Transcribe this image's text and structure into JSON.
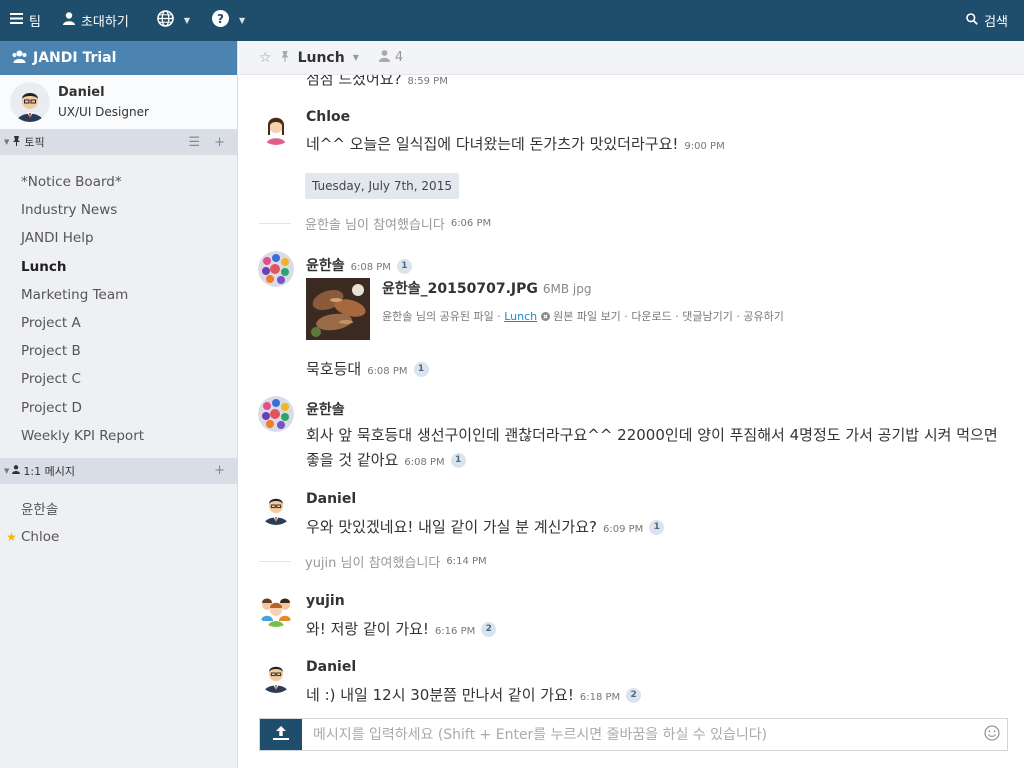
{
  "topbar": {
    "team_label": "팀",
    "invite_label": "초대하기",
    "search_label": "검색"
  },
  "sidebar": {
    "team_name": "JANDI Trial",
    "profile": {
      "name": "Daniel",
      "role": "UX/UI Designer"
    },
    "topics_header": "토픽",
    "topics": [
      "*Notice Board*",
      "Industry News",
      "JANDI Help",
      "Lunch",
      "Marketing Team",
      "Project A",
      "Project B",
      "Project C",
      "Project D",
      "Weekly KPI Report"
    ],
    "dm_header": "1:1 메시지",
    "dms": [
      "윤한솔",
      "Chloe"
    ]
  },
  "channel": {
    "name": "Lunch",
    "member_count": "4"
  },
  "messages": {
    "m0": {
      "text": "점점 드셨어요?",
      "time": "8:59 PM"
    },
    "m1": {
      "sender": "Chloe",
      "text": "네^^ 오늘은 일식집에 다녀왔는데 돈가츠가 맛있더라구요!",
      "time": "9:00 PM"
    },
    "date_divider": "Tuesday, July 7th, 2015",
    "sys1": {
      "text": "윤한솔 님이 참여했습니다",
      "time": "6:06 PM"
    },
    "m2": {
      "sender": "윤한솔",
      "time": "6:08 PM",
      "unread": "1",
      "file_name": "윤한솔_20150707.JPG",
      "file_size": "6MB jpg",
      "shared_label": "윤한솔 님의 공유된 파일 ·",
      "shared_topic": "Lunch",
      "actions": [
        "원본 파일 보기",
        "다운로드",
        "댓글남기기",
        "공유하기"
      ]
    },
    "m3": {
      "text": "묵호등대",
      "time": "6:08 PM",
      "unread": "1"
    },
    "m4": {
      "sender": "윤한솔",
      "line1": "회사 앞 묵호등대 생선구이인데 괜찮더라구요^^ 22000인데 양이 푸짐해서 4명정도 가서 공기밥 시켜 먹으면",
      "line2": "좋을 것 같아요",
      "time": "6:08 PM",
      "unread": "1"
    },
    "m5": {
      "sender": "Daniel",
      "text": "우와 맛있겠네요! 내일 같이 가실 분 계신가요?",
      "time": "6:09 PM",
      "unread": "1"
    },
    "sys2": {
      "text": "yujin 님이 참여했습니다",
      "time": "6:14 PM"
    },
    "m6": {
      "sender": "yujin",
      "text": "와! 저랑 같이 가요!",
      "time": "6:16 PM",
      "unread": "2"
    },
    "m7": {
      "sender": "Daniel",
      "text": "네 :) 내일 12시 30분쯤 만나서 같이 가요!",
      "time": "6:18 PM",
      "unread": "2"
    }
  },
  "composer": {
    "placeholder": "메시지를 입력하세요 (Shift + Enter를 누르시면 줄바꿈을 하실 수 있습니다)"
  },
  "colors": {
    "topbar": "#1f4e6d",
    "team_header": "#4b84b0",
    "link": "#1e88c9",
    "favorite_star": "#f5b800"
  }
}
